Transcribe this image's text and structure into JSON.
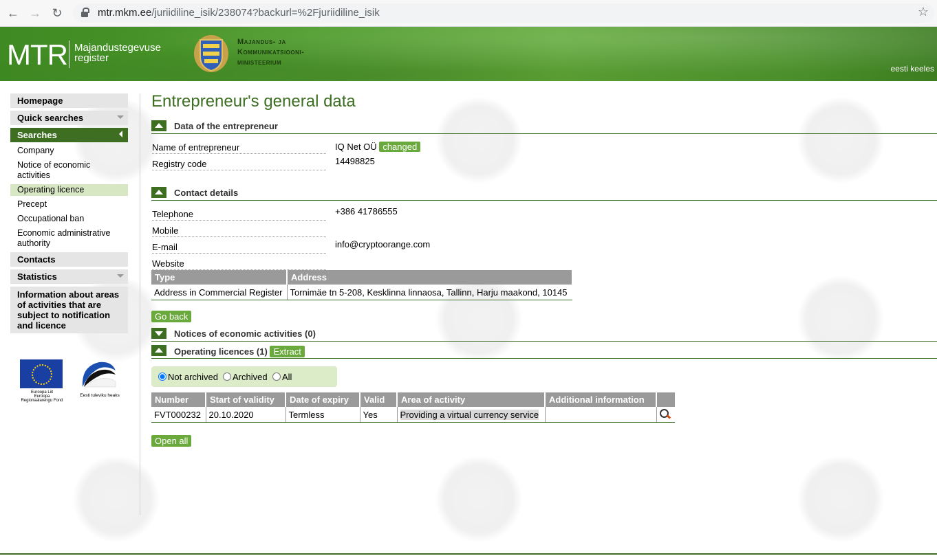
{
  "browser": {
    "url_host": "mtr.mkm.ee",
    "url_path": "/juriidiline_isik/238074?backurl=%2Fjuriidiline_isik"
  },
  "header": {
    "logo": "MTR",
    "logo_sub_1": "Majandustegevuse",
    "logo_sub_2": "register",
    "ministry_1": "Majandus- ja",
    "ministry_2": "Kommunikatsiooni-",
    "ministry_3": "ministeerium",
    "lang_link": "eesti keeles"
  },
  "sidebar": {
    "homepage": "Homepage",
    "quick_searches": "Quick searches",
    "searches": "Searches",
    "search_items": [
      {
        "label": "Company"
      },
      {
        "label": "Notice of economic activities"
      },
      {
        "label": "Operating licence"
      },
      {
        "label": "Precept"
      },
      {
        "label": "Occupational ban"
      },
      {
        "label": "Economic administrative authority"
      }
    ],
    "contacts": "Contacts",
    "statistics": "Statistics",
    "info": "Information about areas of activities that are subject to notification and licence",
    "eu_text_1": "Euroopa Liit",
    "eu_text_2": "Euroopa",
    "eu_text_3": "Regionaalarengu Fond",
    "ee_text": "Eesti tuleviku heaks"
  },
  "main": {
    "title": "Entrepreneur's general data",
    "section_entrepreneur": "Data of the entrepreneur",
    "name_label": "Name of entrepreneur",
    "name_value": "IQ Net OÜ",
    "changed_badge": "changed",
    "reg_label": "Registry code",
    "reg_value": "14498825",
    "section_contact": "Contact details",
    "tel_label": "Telephone",
    "tel_value": "+386 41786555",
    "mobile_label": "Mobile",
    "email_label": "E-mail",
    "email_value": "info@cryptoorange.com",
    "website_label": "Website",
    "addr_head_type": "Type",
    "addr_head_address": "Address",
    "addr_type": "Address in Commercial Register",
    "addr_value": "Tornimäe tn 5-208, Kesklinna linnaosa, Tallinn, Harju maakond, 10145",
    "go_back": "Go back",
    "section_notices": "Notices of economic activities (0)",
    "section_licences": "Operating licences (1)",
    "extract": "Extract",
    "filter_not_archived": "Not archived",
    "filter_archived": "Archived",
    "filter_all": "All",
    "lic_headers": [
      "Number",
      "Start of validity",
      "Date of expiry",
      "Valid",
      "Area of activity",
      "Additional information"
    ],
    "lic_row": {
      "number": "FVT000232",
      "start": "20.10.2020",
      "expiry": "Termless",
      "valid": "Yes",
      "area": "Providing a virtual currency service",
      "info": ""
    },
    "open_all": "Open all"
  },
  "colors": {
    "brand_green": "#3d6e22",
    "accent_green": "#6aaa3c",
    "filter_bg": "#dcebc8"
  }
}
